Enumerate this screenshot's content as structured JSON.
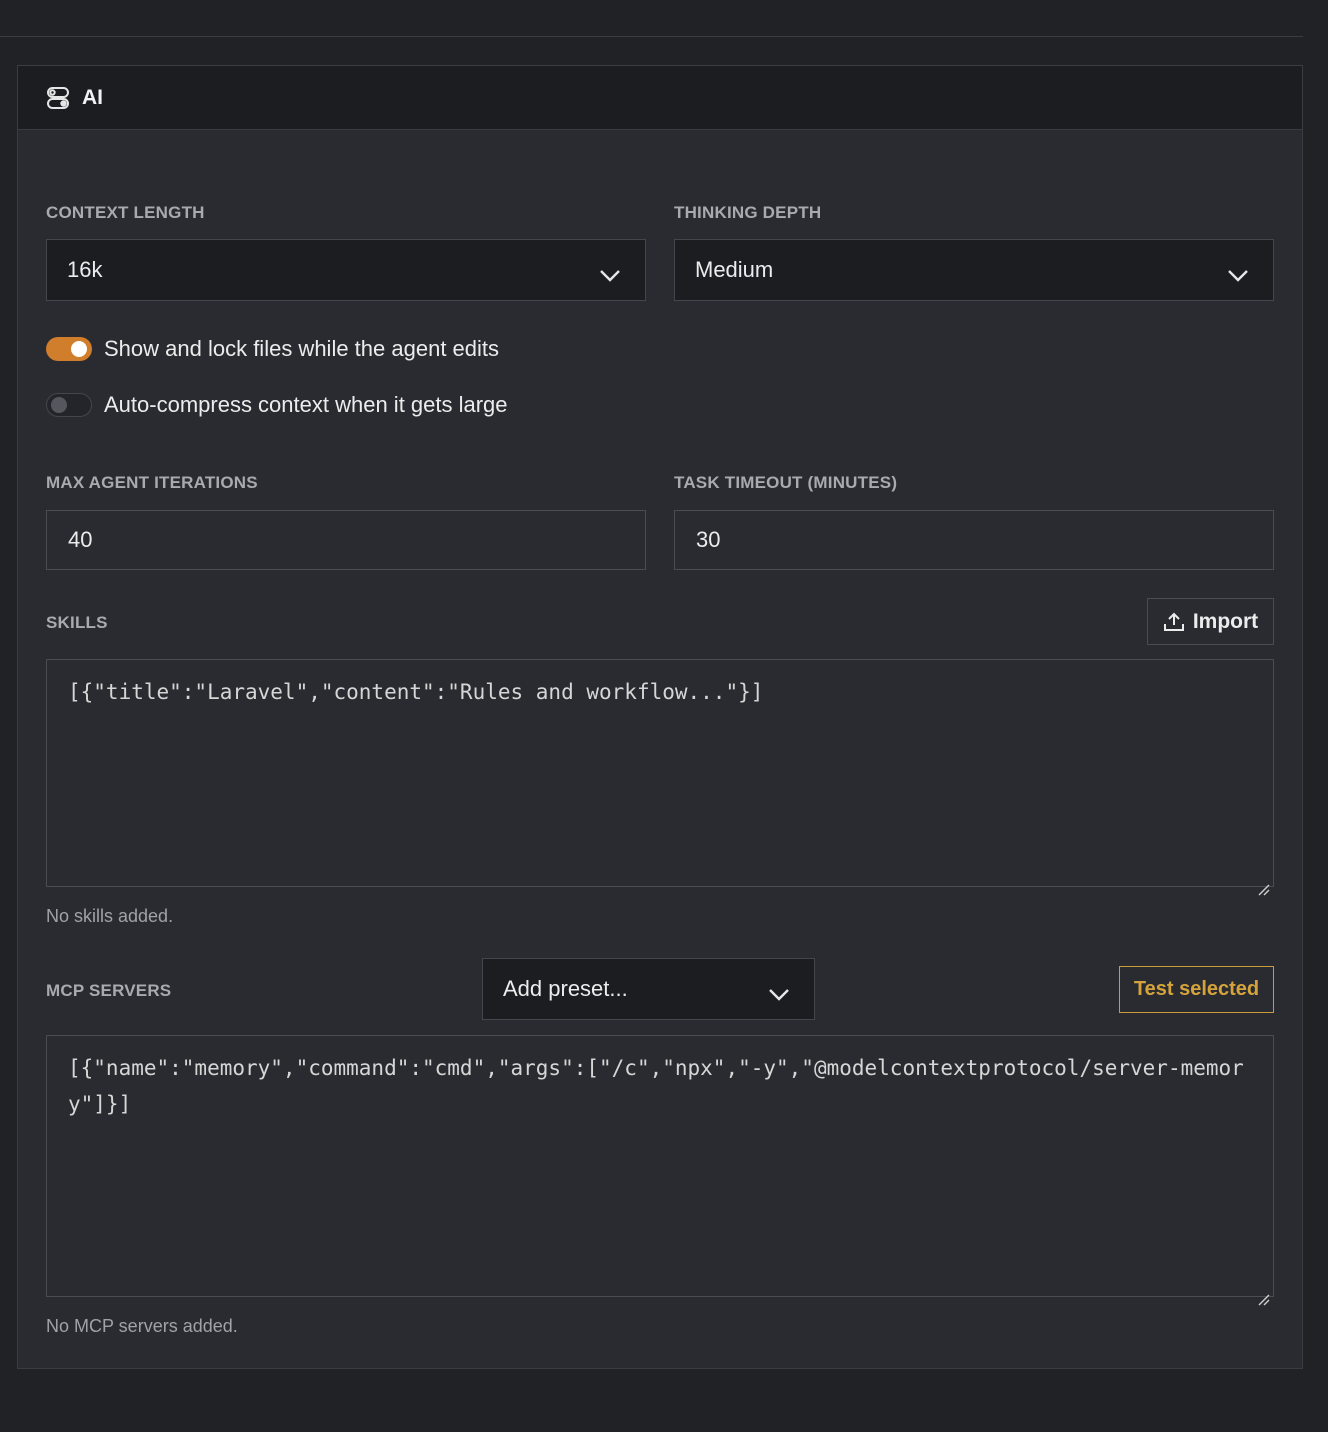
{
  "panel": {
    "title": "AI",
    "icon": "toggles-icon"
  },
  "context_length": {
    "label": "CONTEXT LENGTH",
    "value": "16k"
  },
  "thinking_depth": {
    "label": "THINKING DEPTH",
    "value": "Medium"
  },
  "toggles": [
    {
      "label": "Show and lock files while the agent edits",
      "on": true
    },
    {
      "label": "Auto-compress context when it gets large",
      "on": false
    }
  ],
  "max_iterations": {
    "label": "MAX AGENT ITERATIONS",
    "value": "40"
  },
  "task_timeout": {
    "label": "TASK TIMEOUT (MINUTES)",
    "value": "30"
  },
  "skills": {
    "label": "SKILLS",
    "import_label": "Import",
    "content": "[{\"title\":\"Laravel\",\"content\":\"Rules and workflow...\"}]",
    "empty_hint": "No skills added."
  },
  "mcp": {
    "label": "MCP SERVERS",
    "preset_value": "Add preset...",
    "test_label": "Test selected",
    "content": "[{\"name\":\"memory\",\"command\":\"cmd\",\"args\":[\"/c\",\"npx\",\"-y\",\"@modelcontextprotocol/server-memory\"]}]",
    "empty_hint": "No MCP servers added."
  },
  "colors": {
    "accent": "#d07e2b",
    "test_button": "#d4a33c",
    "panel_bg": "#2a2b30",
    "header_bg": "#1c1d21"
  }
}
